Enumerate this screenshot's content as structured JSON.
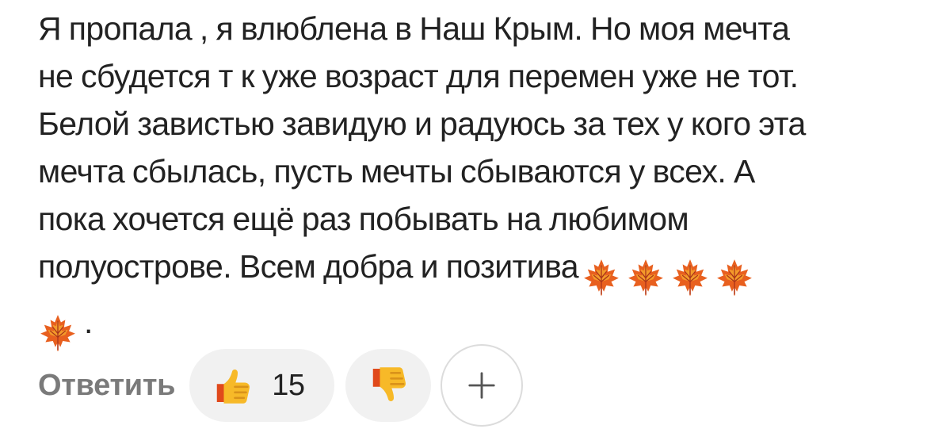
{
  "comment": {
    "lines": [
      "Я пропала , я влюблена в Наш Крым. Но моя мечта",
      "не сбудется т к уже возраст для перемен уже не тот.",
      "Белой завистью завидую и радуюсь за тех у кого эта",
      "мечта сбылась, пусть мечты сбываются у всех. А",
      "пока хочется ещё раз побывать на любимом",
      "полуострове. Всем добра  и позитива"
    ],
    "emoji": "maple-leaf-icon",
    "emoji_count": 5,
    "trailing": "."
  },
  "actions": {
    "reply_label": "Ответить",
    "like_icon": "thumbs-up-icon",
    "like_count": "15",
    "dislike_icon": "thumbs-down-icon",
    "add_reaction_icon": "plus-icon"
  },
  "colors": {
    "text": "#222222",
    "reply": "#7a7a7a",
    "pill_bg": "#f1f1f1",
    "leaf_orange": "#e8601f",
    "thumb_yellow": "#f6b52e"
  }
}
